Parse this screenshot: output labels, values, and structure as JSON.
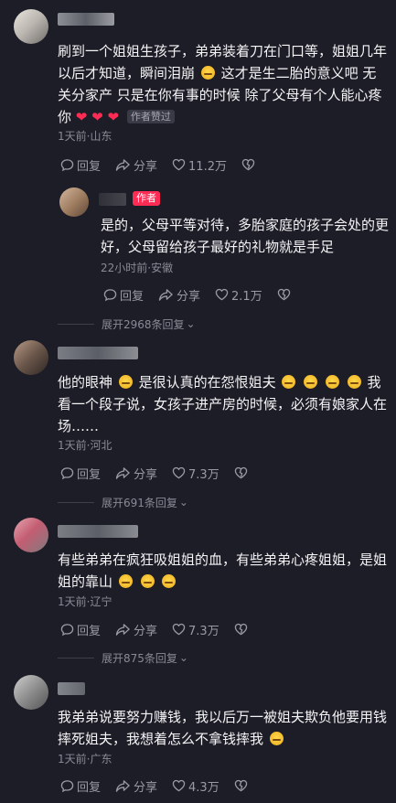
{
  "colors": {
    "accent": "#fe2c55",
    "background": "#1d1d27",
    "meta": "#8a8a96"
  },
  "actions": {
    "reply": "回复",
    "share": "分享"
  },
  "comments": [
    {
      "text": "刷到一个姐姐生孩子，弟弟装着刀在门口等，姐姐几年以后才知道，瞬间泪崩",
      "text_b": "这才是生二胎的意义吧 无关分家产 只是在你有事的时候 除了父母有个人能心疼你",
      "liked_tag": "作者赞过",
      "meta": "1天前·山东",
      "likes": "11.2万",
      "reply": {
        "author_tag": "作者",
        "text": "是的，父母平等对待，多胎家庭的孩子会处的更好，父母留给孩子最好的礼物就是手足",
        "meta": "22小时前·安徽",
        "likes": "2.1万",
        "expand": "展开2968条回复"
      }
    },
    {
      "text_a": "他的眼神",
      "text_b": "是很认真的在怨恨姐夫",
      "text_c": "我看一个段子说，女孩子进产房的时候，必须有娘家人在场……",
      "meta": "1天前·河北",
      "likes": "7.3万",
      "expand": "展开691条回复"
    },
    {
      "text": "有些弟弟在疯狂吸姐姐的血，有些弟弟心疼姐姐，是姐姐的靠山",
      "meta": "1天前·辽宁",
      "likes": "7.3万",
      "expand": "展开875条回复"
    },
    {
      "text": "我弟弟说要努力赚钱，我以后万一被姐夫欺负他要用钱摔死姐夫，我想着怎么不拿钱摔我",
      "meta": "1天前·广东",
      "likes": "4.3万"
    }
  ]
}
